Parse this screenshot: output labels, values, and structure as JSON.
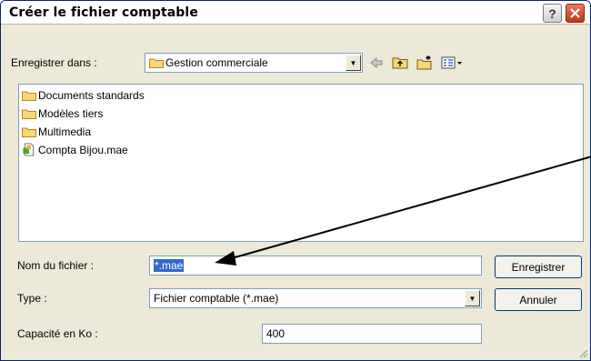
{
  "window": {
    "title": "Créer le fichier comptable",
    "help_label": "?",
    "close_label": "✕"
  },
  "toolbar": {
    "save_in_label": "Enregistrer dans :",
    "location_value": "Gestion commerciale",
    "icons": [
      "back-arrow-icon",
      "up-folder-icon",
      "new-folder-icon",
      "view-menu-icon"
    ]
  },
  "files": [
    {
      "name": "Documents standards",
      "icon": "folder-icon"
    },
    {
      "name": "Modèles tiers",
      "icon": "folder-icon"
    },
    {
      "name": "Multimedia",
      "icon": "folder-icon"
    },
    {
      "name": "Compta Bijou.mae",
      "icon": "file-icon"
    }
  ],
  "form": {
    "filename_label": "Nom du fichier :",
    "filename_value": "*.mae",
    "type_label": "Type :",
    "type_value": "Fichier comptable (*.mae)",
    "capacity_label": "Capacité en Ko :",
    "capacity_value": "400"
  },
  "buttons": {
    "save_label": "Enregistrer",
    "cancel_label": "Annuler"
  },
  "colors": {
    "selection": "#316ac5",
    "close": "#c2351b",
    "annotation_arrow": "#000000"
  }
}
